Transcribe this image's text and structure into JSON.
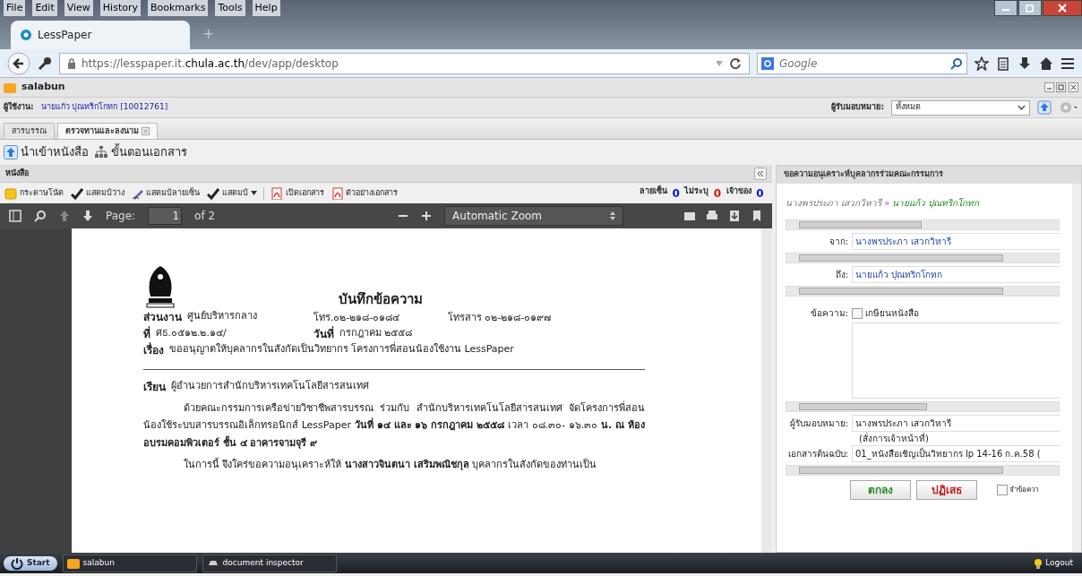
{
  "browser": {
    "menu": [
      "File",
      "Edit",
      "View",
      "History",
      "Bookmarks",
      "Tools",
      "Help"
    ],
    "tab_title": "LessPaper",
    "new_tab": "+",
    "url": "https://lesspaper.it.**chula.ac.th**/dev/app/desktop",
    "search_placeholder": "Google"
  },
  "app": {
    "title": "salabun",
    "user_label": "ผู้ใช้งาน:",
    "user_name": "นายแก้ว ปุณทริกโกทก [10012761]",
    "assignee_label": "ผู้รับมอบหมาย:",
    "assignee_value": "ทั้งหมด",
    "tabs": [
      {
        "label": "สารบรรณ",
        "selected": false,
        "closable": false
      },
      {
        "label": "ตรวจทานและลงนาม",
        "selected": true,
        "closable": true
      }
    ],
    "actions": [
      {
        "label": "นำเข้าหนังสือ",
        "kind": "import"
      },
      {
        "label": "ขั้นตอนเอกสาร",
        "kind": "flow"
      }
    ]
  },
  "letter_panel": {
    "title": "หนังสือ",
    "toolbar": [
      {
        "label": "กระดาษโน้ต",
        "kind": "note"
      },
      {
        "label": "แสตมป์ว่าง",
        "kind": "check"
      },
      {
        "label": "แสตมป์ลายเซ็น",
        "kind": "pen"
      },
      {
        "label": "แสตมป์",
        "kind": "menu"
      },
      {
        "label": "เปิดเอกสาร",
        "kind": "pdf"
      },
      {
        "label": "ตัวอย่างเอกสาร",
        "kind": "pdf"
      }
    ],
    "counts": [
      {
        "label": "ลายเซ็น",
        "value": "0",
        "color": "#1010d0"
      },
      {
        "label": "ไม่ระบุ",
        "value": "0",
        "color": "#e01010"
      },
      {
        "label": "เจ้าของ",
        "value": "0",
        "color": "#1010d0"
      }
    ]
  },
  "pdf_viewer": {
    "page_label": "Page:",
    "page": "1",
    "page_total": "of 2",
    "zoom": "Automatic Zoom"
  },
  "document": {
    "heading": "บันทึกข้อความ",
    "line1": [
      {
        "label": "ส่วนงาน",
        "value": "ศูนย์บริหารกลาง"
      },
      {
        "value": "โทร.๐๒-๒๑๘-๐๑๘๔"
      },
      {
        "value": "โทรสาร ๐๒-๒๑๘-๐๑๙๗"
      }
    ],
    "line2": [
      {
        "label": "ที่",
        "value": "ศธ.๐๕๑๒.๒.๑๔/"
      },
      {
        "label": "วันที่",
        "value": "กรกฎาคม ๒๕๕๘"
      }
    ],
    "subject": {
      "label": "เรื่อง",
      "value": "ขออนุญาตให้บุคลากรในสังกัดเป็นวิทยากร โครงการพี่สอนน้องใช้งาน LessPaper"
    },
    "to": {
      "label": "เรียน",
      "value": "ผู้อำนวยการสำนักบริหารเทคโนโลยีสารสนเทศ"
    },
    "paragraphs": [
      "ด้วยคณะกรรมการเครือข่ายวิชาชีพสารบรรณ ร่วมกับ สำนักบริหารเทคโนโลยีสารสนเทศ จัดโครงการพี่สอนน้องใช้ระบบสารบรรณอิเล็กทรอนิกส์ LessPaper **วันที่ ๑๔ และ ๑๖ กรกฎาคม ๒๕๕๘** เวลา ๐๘.๓๐- ๑๖.๓๐ **น. ณ ห้องอบรมคอมพิวเตอร์ ชั้น ๔ อาคารจามจุรี ๙**",
      "ในการนี้ จึงใคร่ขอความอนุเคราะห์ให้ **นางสาวจินตนา  เสริมพณิชกุล** บุคลากรในสังกัดของท่านเป็น"
    ]
  },
  "side_panel": {
    "title": "ขอความอนุเคราะห์บุคลากรร่วมคณะกรรมการ",
    "route_from": "นางพรประภา เสวกวิหารี",
    "route_sep": "»",
    "route_to": "นายแก้ว ปุณทริกโกทก",
    "from_label": "จาก:",
    "from_value": "นางพรประภา เสวกวิหารี",
    "to_label": "ถึง:",
    "to_value": "นายแก้ว ปุณทริกโกทก",
    "message_label": "ข้อความ:",
    "endorse": {
      "label": "เกษียนหนังสือ",
      "checked": false
    },
    "assignee_label": "ผู้รับมอบหมาย:",
    "assignee_value": "นางพรประภา เสวกวิหารี",
    "assignee_note": "(สั่งการเจ้าหน้าที่)",
    "original_label": "เอกสารต้นฉบับ:",
    "original_value": "01_หนังสือเชิญเป็นวิทยากร  lp 14-16 ก.ค.58 (",
    "ok": "ตกลง",
    "reject": "ปฏิเสธ",
    "remember": {
      "label": "จำข้อควา",
      "checked": false
    }
  },
  "taskbar": {
    "start": "Start",
    "items": [
      {
        "label": "salabun",
        "kind": "folder"
      },
      {
        "label": "document inspector",
        "kind": "inspector"
      }
    ],
    "logout": "Logout"
  }
}
